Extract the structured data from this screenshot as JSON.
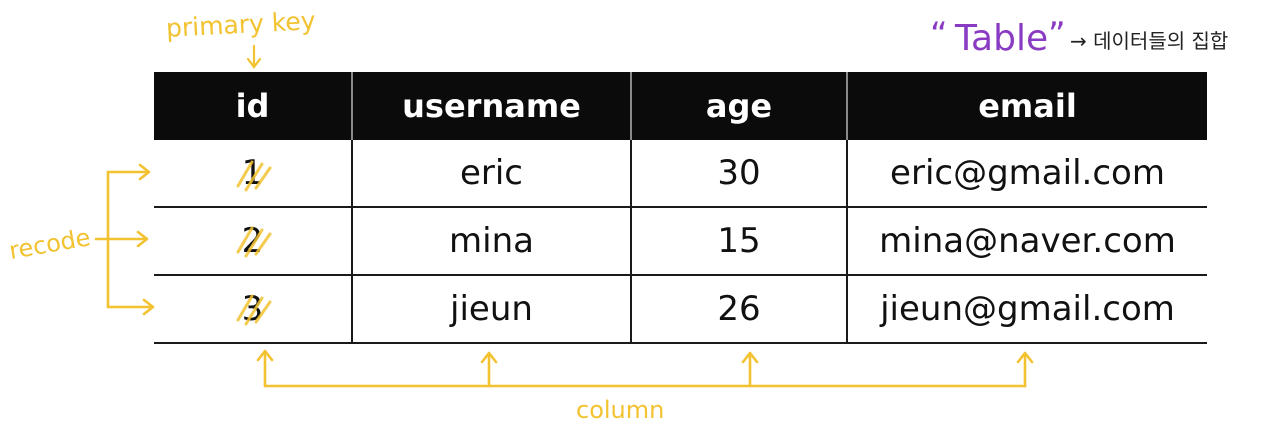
{
  "annotations": {
    "primary_key": "primary key",
    "table_quote_open": "“",
    "table_word": "Table",
    "table_quote_close": "”",
    "table_desc": "→ 데이터들의 집합",
    "record": "recode",
    "column": "column"
  },
  "table": {
    "headers": [
      "id",
      "username",
      "age",
      "email"
    ],
    "rows": [
      [
        "1",
        "eric",
        "30",
        "eric@gmail.com"
      ],
      [
        "2",
        "mina",
        "15",
        "mina@naver.com"
      ],
      [
        "3",
        "jieun",
        "26",
        "jieun@gmail.com"
      ]
    ]
  },
  "colors": {
    "annotation": "#f2c230",
    "table_label": "#8a3bc4",
    "header_bg": "#0b0b0b"
  }
}
